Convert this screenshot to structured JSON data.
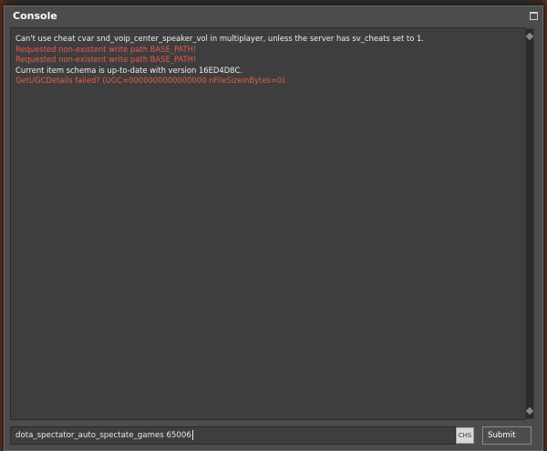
{
  "window": {
    "title": "Console"
  },
  "log": {
    "lines": [
      {
        "text": "Can't use cheat cvar snd_voip_center_speaker_vol in multiplayer, unless the server has sv_cheats set to 1.",
        "color": "#f0f0f0"
      },
      {
        "text": "Requested non-existent write path BASE_PATH!",
        "color": "#e85a50"
      },
      {
        "text": "Requested non-existent write path BASE_PATH!",
        "color": "#e85a50"
      },
      {
        "text": "Current item schema is up-to-date with version 16ED4D8C.",
        "color": "#f0f0f0"
      },
      {
        "text": "GetUGCDetails failed? (UGC=0000000000000000 nFileSizeInBytes=0).",
        "color": "#e85a50"
      }
    ]
  },
  "input": {
    "value": "dota_spectator_auto_spectate_games 65006",
    "ime_label": "CHS"
  },
  "submit": {
    "label": "Submit"
  },
  "icons": {
    "maximize": "maximize-icon",
    "scroll_up": "scroll-up-arrow-icon",
    "scroll_down": "scroll-down-arrow-icon"
  }
}
